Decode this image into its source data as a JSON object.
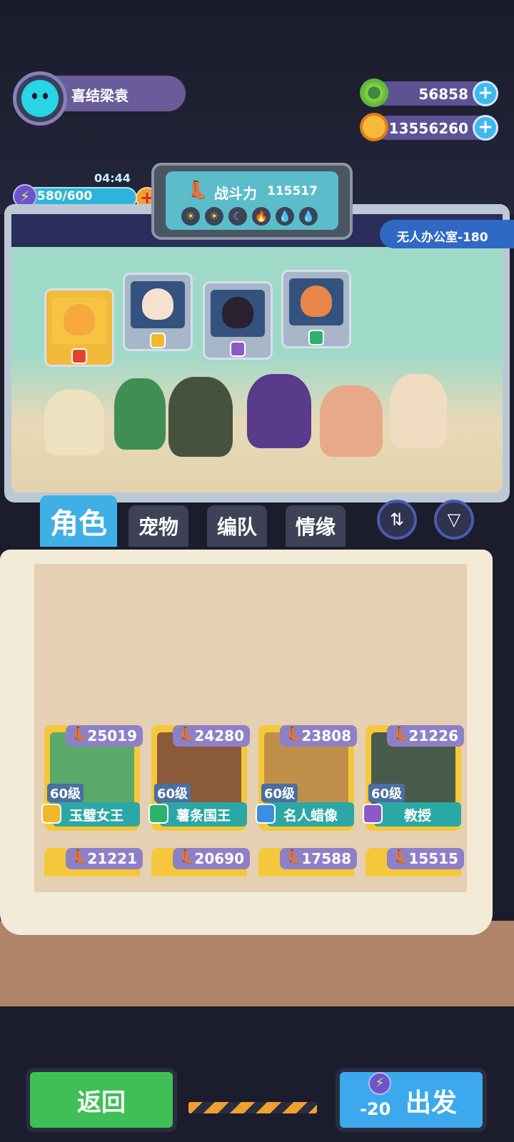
{
  "player": {
    "name": "喜结梁袁",
    "avatar_icon": "cat-face-icon"
  },
  "resources": {
    "gems": {
      "value": "56858",
      "icon": "green-gem-icon"
    },
    "coins": {
      "value": "13556260",
      "icon": "planet-coin-icon"
    }
  },
  "energy": {
    "timer": "04:44",
    "value": "580/600",
    "icon": "lightning-icon"
  },
  "team_power": {
    "label": "战斗力",
    "value": "115517",
    "elements": [
      "sun-icon",
      "sun-icon",
      "moon-icon",
      "fire-icon",
      "water-icon",
      "water-icon"
    ]
  },
  "stage": {
    "label": "无人办公室-180"
  },
  "pets": [
    {
      "color": "#f7a93c",
      "badge": "#e0442b"
    },
    {
      "color": "#f6e1d0",
      "badge": "#f0b82a"
    },
    {
      "color": "#2a2030",
      "badge": "#8a5ac8"
    },
    {
      "color": "#e8864a",
      "badge": "#2ab36a"
    }
  ],
  "tabs": [
    {
      "label": "角色",
      "active": true
    },
    {
      "label": "宠物",
      "active": false
    },
    {
      "label": "编队",
      "active": false
    },
    {
      "label": "情缘",
      "active": false
    }
  ],
  "roster": [
    {
      "power": "25019",
      "level": "60级",
      "name": "玉璧女王",
      "badge": "#f0b82a",
      "pic": "#5aa96a"
    },
    {
      "power": "24280",
      "level": "60级",
      "name": "薯条国王",
      "badge": "#2ab36a",
      "pic": "#8a5a3a"
    },
    {
      "power": "23808",
      "level": "60级",
      "name": "名人蜡像",
      "badge": "#3a8fe0",
      "pic": "#c0904a"
    },
    {
      "power": "21226",
      "level": "60级",
      "name": "教授",
      "badge": "#8a5ac8",
      "pic": "#4a5a4a"
    }
  ],
  "roster_row2": [
    {
      "power": "21221"
    },
    {
      "power": "20690"
    },
    {
      "power": "17588"
    },
    {
      "power": "15515"
    }
  ],
  "buttons": {
    "back": "返回",
    "go": "出发",
    "go_cost": "-20"
  }
}
